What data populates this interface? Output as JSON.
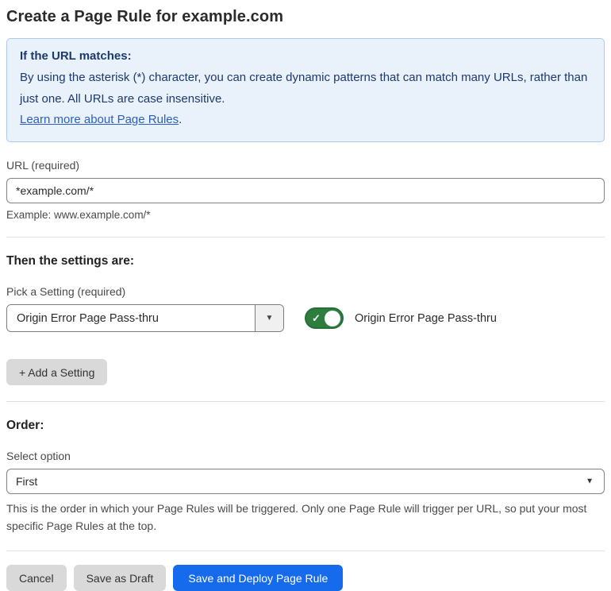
{
  "page": {
    "title": "Create a Page Rule for example.com"
  },
  "info_box": {
    "heading": "If the URL matches:",
    "body": "By using the asterisk (*) character, you can create dynamic patterns that can match many URLs, rather than just one. All URLs are case insensitive.",
    "link_label": "Learn more about Page Rules",
    "link_suffix": "."
  },
  "url_field": {
    "label": "URL (required)",
    "value": "*example.com/*",
    "example": "Example: www.example.com/*"
  },
  "settings_section": {
    "heading": "Then the settings are:",
    "pick_label": "Pick a Setting (required)",
    "selected_setting": "Origin Error Page Pass-thru",
    "dropdown_caret": "▼",
    "toggle_state": "on",
    "toggle_check": "✓",
    "toggle_label": "Origin Error Page Pass-thru",
    "add_button_label": "+ Add a Setting"
  },
  "order_section": {
    "heading": "Order:",
    "label": "Select option",
    "selected_option": "First",
    "dropdown_caret": "▼",
    "help": "This is the order in which your Page Rules will be triggered. Only one Page Rule will trigger per URL, so put your most specific Page Rules at the top."
  },
  "footer": {
    "cancel_label": "Cancel",
    "save_draft_label": "Save as Draft",
    "save_deploy_label": "Save and Deploy Page Rule"
  },
  "colors": {
    "accent_blue": "#166bed",
    "toggle_green": "#2f7d3e",
    "info_box_bg": "#e9f1fb",
    "info_box_border": "#abc9ec",
    "info_text": "#1d3a6d",
    "link_blue": "#2b5fc0",
    "gray_button_bg": "#d9d9d9"
  }
}
